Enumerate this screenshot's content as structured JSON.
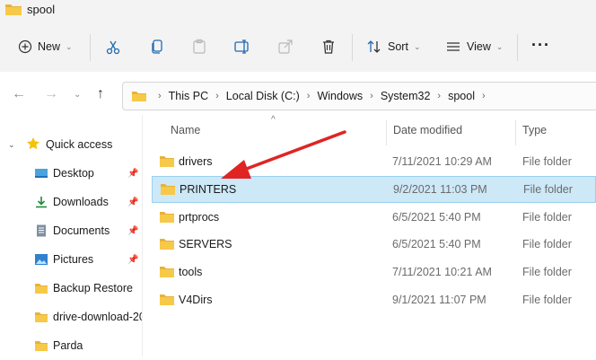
{
  "window": {
    "title": "spool"
  },
  "toolbar": {
    "new_label": "New",
    "sort_label": "Sort",
    "view_label": "View",
    "more_label": "···"
  },
  "address": {
    "crumbs": [
      "This PC",
      "Local Disk (C:)",
      "Windows",
      "System32",
      "spool"
    ]
  },
  "sidebar": {
    "quick_access_label": "Quick access",
    "items": [
      {
        "label": "Desktop",
        "icon": "desktop-icon",
        "pinned": true
      },
      {
        "label": "Downloads",
        "icon": "download-icon",
        "pinned": true
      },
      {
        "label": "Documents",
        "icon": "documents-icon",
        "pinned": true
      },
      {
        "label": "Pictures",
        "icon": "pictures-icon",
        "pinned": true
      },
      {
        "label": "Backup Restore",
        "icon": "folder-icon",
        "pinned": false
      },
      {
        "label": "drive-download-20",
        "icon": "folder-icon",
        "pinned": false
      },
      {
        "label": "Parda",
        "icon": "folder-icon",
        "pinned": false
      }
    ]
  },
  "columns": {
    "name": "Name",
    "date": "Date modified",
    "type": "Type"
  },
  "files": [
    {
      "name": "drivers",
      "date": "7/11/2021 10:29 AM",
      "type": "File folder",
      "selected": false
    },
    {
      "name": "PRINTERS",
      "date": "9/2/2021 11:03 PM",
      "type": "File folder",
      "selected": true
    },
    {
      "name": "prtprocs",
      "date": "6/5/2021 5:40 PM",
      "type": "File folder",
      "selected": false
    },
    {
      "name": "SERVERS",
      "date": "6/5/2021 5:40 PM",
      "type": "File folder",
      "selected": false
    },
    {
      "name": "tools",
      "date": "7/11/2021 10:21 AM",
      "type": "File folder",
      "selected": false
    },
    {
      "name": "V4Dirs",
      "date": "9/1/2021 11:07 PM",
      "type": "File folder",
      "selected": false
    }
  ],
  "colors": {
    "folder": "#f7c948",
    "selection": "#cde8f7",
    "annotation_arrow": "#e02424"
  }
}
